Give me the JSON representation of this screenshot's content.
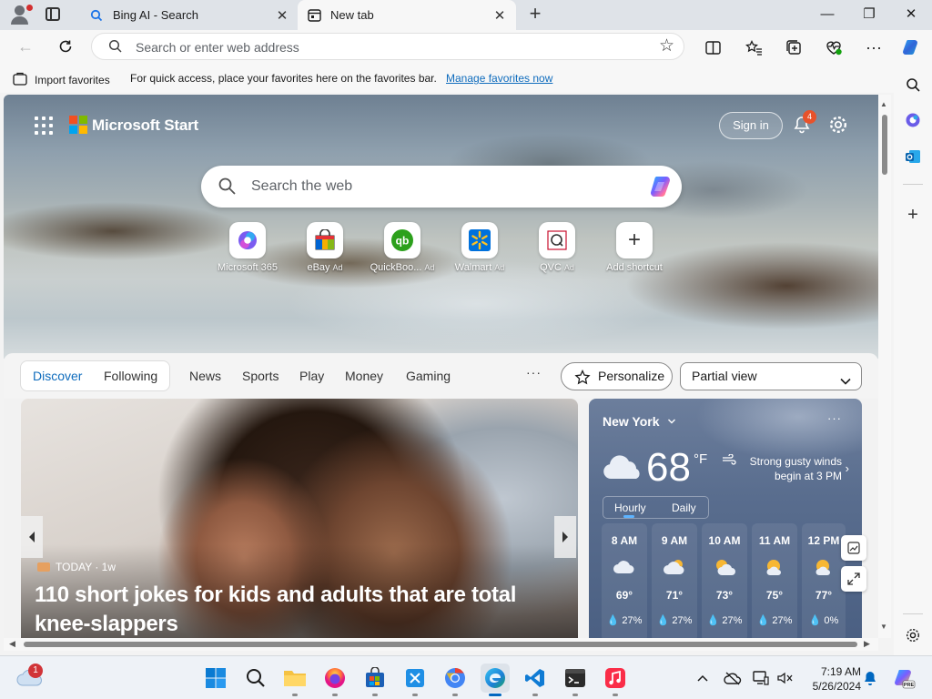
{
  "tabs": [
    {
      "label": "Bing AI - Search"
    },
    {
      "label": "New tab"
    }
  ],
  "window_controls": {
    "minimize": "—",
    "restore": "❐",
    "close": "✕"
  },
  "address_bar": {
    "placeholder": "Search or enter web address"
  },
  "favorites_bar": {
    "import_label": "Import favorites",
    "message": "For quick access, place your favorites here on the favorites bar.",
    "manage_link": "Manage favorites now"
  },
  "start": {
    "brand": "Microsoft Start",
    "sign_in": "Sign in",
    "notification_count": "4",
    "search_placeholder": "Search the web",
    "quick_links": [
      {
        "label": "Microsoft 365",
        "ad": ""
      },
      {
        "label": "eBay",
        "ad": "Ad"
      },
      {
        "label": "QuickBoo...",
        "ad": "Ad"
      },
      {
        "label": "Walmart",
        "ad": "Ad"
      },
      {
        "label": "QVC",
        "ad": "Ad"
      },
      {
        "label": "Add shortcut",
        "ad": ""
      }
    ]
  },
  "feed": {
    "tabs": [
      "Discover",
      "Following",
      "News",
      "Sports",
      "Play",
      "Money",
      "Gaming"
    ],
    "more": "···",
    "personalize": "Personalize",
    "view_select": "Partial view"
  },
  "article": {
    "source": "TODAY · 1w",
    "headline": "110 short jokes for kids and adults that are total knee-slappers"
  },
  "weather": {
    "city": "New York",
    "temp": "68",
    "unit": "°F",
    "alert": "Strong gusty winds begin at 3 PM",
    "toggle": [
      "Hourly",
      "Daily"
    ],
    "hours": [
      {
        "time": "8 AM",
        "temp": "69°",
        "precip": "27%",
        "icon": "cloudy-icon"
      },
      {
        "time": "9 AM",
        "temp": "71°",
        "precip": "27%",
        "icon": "partly-sunny-icon"
      },
      {
        "time": "10 AM",
        "temp": "73°",
        "precip": "27%",
        "icon": "partly-sunny-icon"
      },
      {
        "time": "11 AM",
        "temp": "75°",
        "precip": "27%",
        "icon": "mostly-sunny-icon"
      },
      {
        "time": "12 PM",
        "temp": "77°",
        "precip": "0%",
        "icon": "mostly-sunny-icon"
      }
    ]
  },
  "taskbar": {
    "notification_badge": "1",
    "time": "7:19 AM",
    "date": "5/26/2024"
  },
  "colors": {
    "accent": "#0f6cbd",
    "ms_red": "#f25022",
    "ms_green": "#7fba00",
    "ms_blue": "#00a4ef",
    "ms_yellow": "#ffb900"
  }
}
